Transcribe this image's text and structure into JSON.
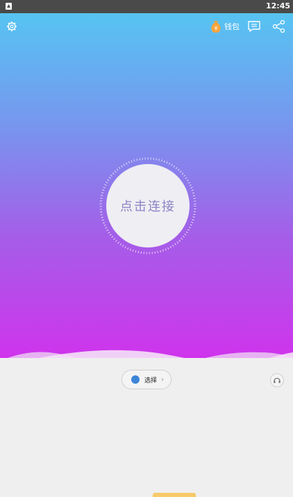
{
  "status_bar": {
    "time": "12:45"
  },
  "header": {
    "wallet_label": "钱包",
    "icons": [
      "settings-icon",
      "wallet-icon",
      "message-icon",
      "share-icon"
    ]
  },
  "connect": {
    "label": "点击连接"
  },
  "select": {
    "label": "选择",
    "chevron": "›",
    "dot_color": "#3d85d8"
  },
  "colors": {
    "gradient_top": "#56c4f2",
    "gradient_bottom": "#cf34ec",
    "accent": "#f6c969"
  }
}
